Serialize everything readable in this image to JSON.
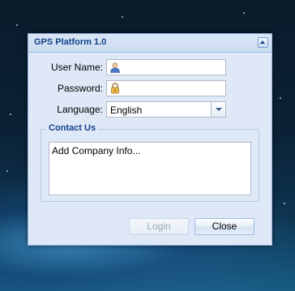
{
  "window": {
    "title": "GPS Platform 1.0",
    "collapse_icon": "chevron-up-icon"
  },
  "form": {
    "username": {
      "label": "User Name:",
      "value": "",
      "icon": "user-icon"
    },
    "password": {
      "label": "Password:",
      "value": "",
      "icon": "lock-icon"
    },
    "language": {
      "label": "Language:",
      "value": "English",
      "trigger_icon": "chevron-down-icon"
    }
  },
  "contact": {
    "legend": "Contact Us",
    "text": "Add Company Info..."
  },
  "buttons": {
    "login": "Login",
    "close": "Close"
  },
  "colors": {
    "title_text": "#15428b",
    "panel_bg": "#dfe8f6",
    "border": "#99bbe8"
  }
}
